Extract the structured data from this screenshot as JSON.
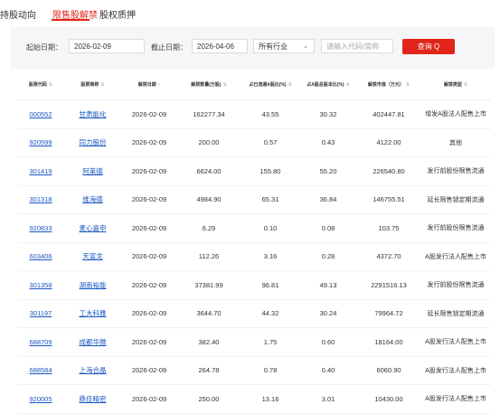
{
  "tabs": [
    {
      "label": "持股动向"
    },
    {
      "label": "限售股解禁"
    },
    {
      "label": "股权质押"
    }
  ],
  "filters": {
    "start_label": "起始日期：",
    "start_value": "2026-02-09",
    "end_label": "截止日期：",
    "end_value": "2026-04-06",
    "industry_value": "所有行业",
    "industry_arrow": "⌄",
    "search_placeholder": "请输入代码/简称",
    "query_label": "查询 Q"
  },
  "table": {
    "headers": [
      "股票代码",
      "股票简称",
      "解禁日期",
      "解禁数量(万股)",
      "占已流通A股比(%)",
      "占A股总股本比(%)",
      "解禁市值（万元）",
      "解禁类型"
    ],
    "sort_glyph": "⇅",
    "sort_active_glyph": "↑",
    "rows": [
      {
        "code": "000552",
        "name": "甘肃能化",
        "date": "2026-02-09",
        "qty": "162277.34",
        "float_pct": "43.55",
        "total_pct": "30.32",
        "value": "402447.81",
        "type": "增发A股法人配售上市"
      },
      {
        "code": "920599",
        "name": "同力股份",
        "date": "2026-02-09",
        "qty": "200.00",
        "float_pct": "0.57",
        "total_pct": "0.43",
        "value": "4122.00",
        "type": "其他"
      },
      {
        "code": "301419",
        "name": "阿莱德",
        "date": "2026-02-09",
        "qty": "6624.00",
        "float_pct": "155.80",
        "total_pct": "55.20",
        "value": "226540.80",
        "type": "发行前股份限售流通"
      },
      {
        "code": "301318",
        "name": "维海德",
        "date": "2026-02-09",
        "qty": "4984.90",
        "float_pct": "65.31",
        "total_pct": "36.84",
        "value": "146755.51",
        "type": "延长限售锁定期流通"
      },
      {
        "code": "920833",
        "name": "麦心嘉申",
        "date": "2026-02-09",
        "qty": "6.29",
        "float_pct": "0.10",
        "total_pct": "0.08",
        "value": "103.75",
        "type": "发行前股份限售流通"
      },
      {
        "code": "603406",
        "name": "天富龙",
        "date": "2026-02-09",
        "qty": "112.26",
        "float_pct": "3.16",
        "total_pct": "0.28",
        "value": "4372.70",
        "type": "A股发行法人配售上市"
      },
      {
        "code": "301358",
        "name": "湖南裕能",
        "date": "2026-02-09",
        "qty": "37381.99",
        "float_pct": "96.81",
        "total_pct": "49.13",
        "value": "2291516.13",
        "type": "发行前股份限售流通"
      },
      {
        "code": "301197",
        "name": "工大科雅",
        "date": "2026-02-09",
        "qty": "3644.70",
        "float_pct": "44.32",
        "total_pct": "30.24",
        "value": "79964.72",
        "type": "延长限售锁定期流通"
      },
      {
        "code": "688709",
        "name": "成都华微",
        "date": "2026-02-09",
        "qty": "382.40",
        "float_pct": "1.75",
        "total_pct": "0.60",
        "value": "18164.00",
        "type": "A股发行法人配售上市"
      },
      {
        "code": "688584",
        "name": "上海合晶",
        "date": "2026-02-09",
        "qty": "264.78",
        "float_pct": "0.78",
        "total_pct": "0.40",
        "value": "6060.90",
        "type": "A股发行法人配售上市"
      },
      {
        "code": "920005",
        "name": "鼎佳精密",
        "date": "2026-02-09",
        "qty": "250.00",
        "float_pct": "13.16",
        "total_pct": "3.01",
        "value": "10430.00",
        "type": "A股发行法人配售上市"
      }
    ]
  }
}
